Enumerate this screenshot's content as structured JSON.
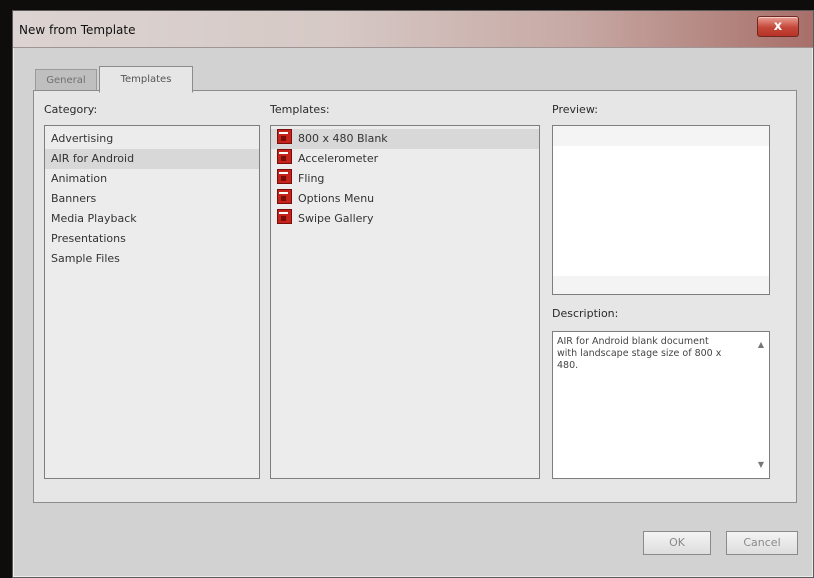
{
  "window": {
    "title": "New from Template",
    "close_label": "x"
  },
  "tabs": [
    {
      "label": "General",
      "active": false
    },
    {
      "label": "Templates",
      "active": true
    }
  ],
  "category": {
    "label": "Category:",
    "items": [
      "Advertising",
      "AIR for Android",
      "Animation",
      "Banners",
      "Media Playback",
      "Presentations",
      "Sample Files"
    ],
    "selected": "AIR for Android"
  },
  "templates": {
    "label": "Templates:",
    "items": [
      "800 x 480 Blank",
      "Accelerometer",
      "Fling",
      "Options Menu",
      "Swipe Gallery"
    ],
    "selected": "800 x 480 Blank",
    "icon": "flash-template-icon"
  },
  "preview": {
    "label": "Preview:"
  },
  "description": {
    "label": "Description:",
    "text": "AIR for Android blank document with landscape stage size of 800 x 480."
  },
  "buttons": {
    "ok": "OK",
    "cancel": "Cancel"
  },
  "colors": {
    "icon_red": "#c4221a",
    "close_red": "#c4483a",
    "selection": "#d8d8d8"
  }
}
